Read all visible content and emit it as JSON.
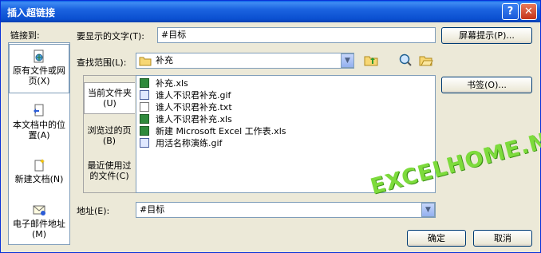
{
  "window": {
    "title": "插入超链接"
  },
  "titlebar": {
    "help_label": "?",
    "close_label": "✕"
  },
  "link_to": {
    "label": "链接到:",
    "items": [
      {
        "label": "原有文件或网页(X)",
        "icon": "globe-file-icon"
      },
      {
        "label": "本文档中的位置(A)",
        "icon": "document-place-icon"
      },
      {
        "label": "新建文档(N)",
        "icon": "new-document-icon"
      },
      {
        "label": "电子邮件地址(M)",
        "icon": "email-icon"
      }
    ]
  },
  "text_to_display": {
    "label": "要显示的文字(T):",
    "value": "#目标"
  },
  "screen_tip_button": "屏幕提示(P)...",
  "look_in": {
    "label": "查找范围(L):",
    "value": "补充"
  },
  "bookmark_button": "书签(O)...",
  "tabs": [
    {
      "label": "当前文件夹(U)"
    },
    {
      "label": "浏览过的页(B)"
    },
    {
      "label": "最近使用过的文件(C)"
    }
  ],
  "files": [
    {
      "name": "补充.xls",
      "type": "xls"
    },
    {
      "name": "谁人不识君补充.gif",
      "type": "gif"
    },
    {
      "name": "谁人不识君补充.txt",
      "type": "txt"
    },
    {
      "name": "谁人不识君补充.xls",
      "type": "xls"
    },
    {
      "name": "新建 Microsoft Excel 工作表.xls",
      "type": "xls"
    },
    {
      "name": "用活名称演练.gif",
      "type": "gif"
    }
  ],
  "address": {
    "label": "地址(E):",
    "value": "#目标"
  },
  "ok_button": "确定",
  "cancel_button": "取消",
  "watermark": "EXCELHOME.NET"
}
